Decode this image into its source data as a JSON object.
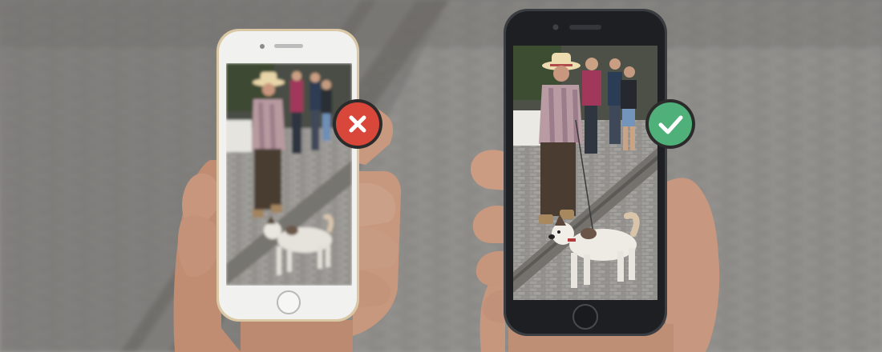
{
  "scene": {
    "description_free": true,
    "colors": {
      "background_street": "#8a8986",
      "pavement_stone": "#9d9b97",
      "curb": "#6f6e6b",
      "skin": "#c99a82",
      "skin_shadow": "#a5735c",
      "phone_left_body": "#f1f1ef",
      "phone_left_rim": "#d9c7a6",
      "phone_right_body": "#1d1f22",
      "phone_right_rim": "#3a3d41",
      "badge_fail": "#d9473b",
      "badge_pass": "#4fb07a",
      "badge_ring": "#2b2b2b"
    }
  },
  "phones": [
    {
      "id": "left-phone",
      "variant": "blurred",
      "badge_icon": "close-icon"
    },
    {
      "id": "right-phone",
      "variant": "sharp",
      "badge_icon": "check-icon"
    }
  ]
}
